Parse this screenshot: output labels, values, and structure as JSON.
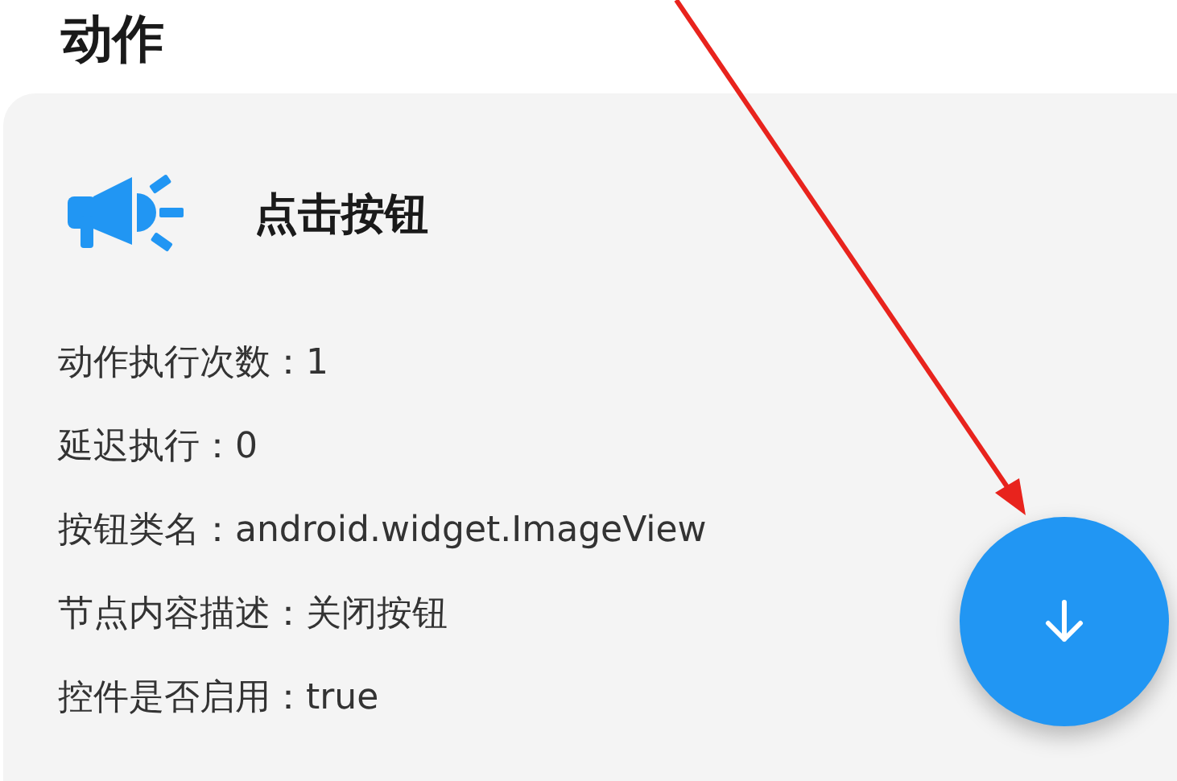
{
  "section_title": "动作",
  "action": {
    "title": "点击按钮"
  },
  "details": [
    "动作执行次数：1",
    "延迟执行：0",
    "按钮类名：android.widget.ImageView",
    "节点内容描述：关闭按钮",
    "控件是否启用：true"
  ],
  "annotations": [
    {
      "kind": "arrow"
    }
  ]
}
